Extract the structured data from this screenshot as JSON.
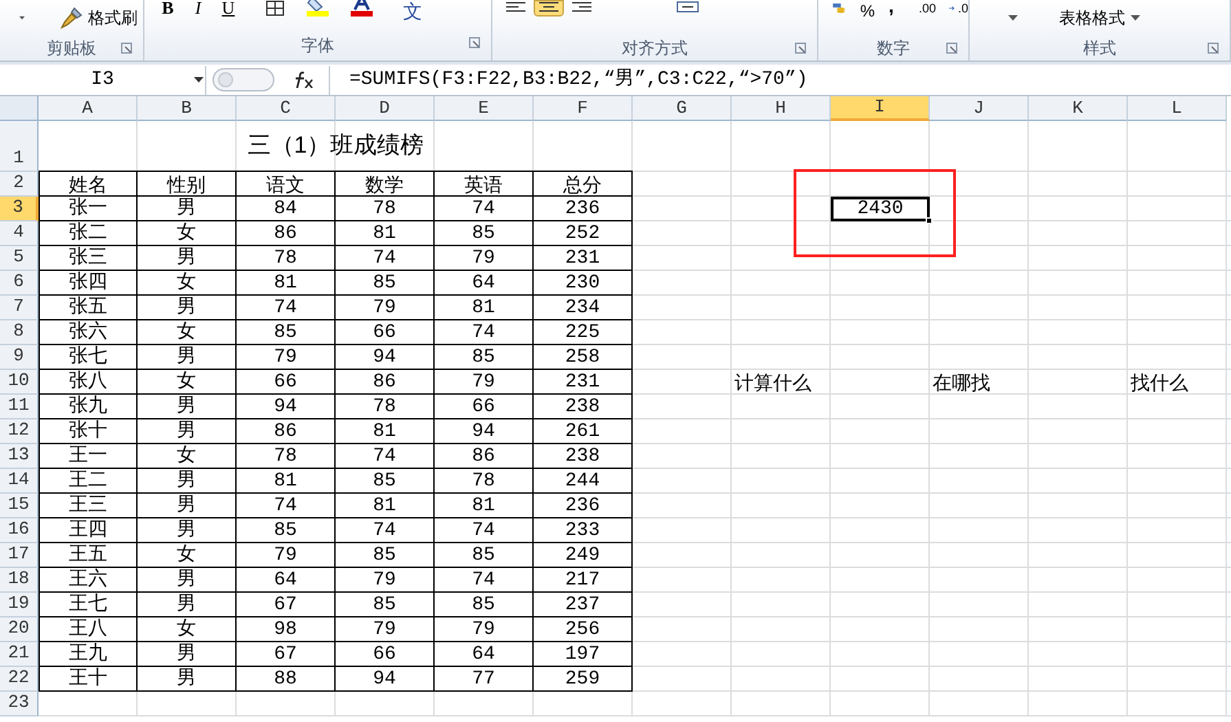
{
  "ribbon": {
    "groups": [
      {
        "label": "剪贴板"
      },
      {
        "label": "字体"
      },
      {
        "label": "对齐方式"
      },
      {
        "label": "数字"
      },
      {
        "label": "样式"
      }
    ],
    "format_painter": "格式刷",
    "bold": "B",
    "italic": "I",
    "underline": "U",
    "phonetic": "文",
    "percent": "%",
    "comma": ",",
    "decimal_buttons": [
      ".00",
      ".0"
    ],
    "table_format": "表格格式"
  },
  "formula_bar": {
    "name_box": "I3",
    "formula": "=SUMIFS(F3:F22,B3:B22,“男”,C3:C22,“>70”)"
  },
  "columns": [
    {
      "label": "A",
      "selected": false
    },
    {
      "label": "B",
      "selected": false
    },
    {
      "label": "C",
      "selected": false
    },
    {
      "label": "D",
      "selected": false
    },
    {
      "label": "E",
      "selected": false
    },
    {
      "label": "F",
      "selected": false
    },
    {
      "label": "G",
      "selected": false
    },
    {
      "label": "H",
      "selected": false
    },
    {
      "label": "I",
      "selected": true
    },
    {
      "label": "J",
      "selected": false
    },
    {
      "label": "K",
      "selected": false
    },
    {
      "label": "L",
      "selected": false
    }
  ],
  "rows": [
    {
      "label": "1",
      "selected": false
    },
    {
      "label": "2",
      "selected": false
    },
    {
      "label": "3",
      "selected": true
    },
    {
      "label": "4",
      "selected": false
    },
    {
      "label": "5",
      "selected": false
    },
    {
      "label": "6",
      "selected": false
    },
    {
      "label": "7",
      "selected": false
    },
    {
      "label": "8",
      "selected": false
    },
    {
      "label": "9",
      "selected": false
    },
    {
      "label": "10",
      "selected": false
    },
    {
      "label": "11",
      "selected": false
    },
    {
      "label": "12",
      "selected": false
    },
    {
      "label": "13",
      "selected": false
    },
    {
      "label": "14",
      "selected": false
    },
    {
      "label": "15",
      "selected": false
    },
    {
      "label": "16",
      "selected": false
    },
    {
      "label": "17",
      "selected": false
    },
    {
      "label": "18",
      "selected": false
    },
    {
      "label": "19",
      "selected": false
    },
    {
      "label": "20",
      "selected": false
    },
    {
      "label": "21",
      "selected": false
    },
    {
      "label": "22",
      "selected": false
    },
    {
      "label": "23",
      "selected": false
    }
  ],
  "table": {
    "title": "三（1）班成绩榜",
    "columns": [
      "姓名",
      "性别",
      "语文",
      "数学",
      "英语",
      "总分"
    ],
    "rows": [
      [
        "张一",
        "男",
        "84",
        "78",
        "74",
        "236"
      ],
      [
        "张二",
        "女",
        "86",
        "81",
        "85",
        "252"
      ],
      [
        "张三",
        "男",
        "78",
        "74",
        "79",
        "231"
      ],
      [
        "张四",
        "女",
        "81",
        "85",
        "64",
        "230"
      ],
      [
        "张五",
        "男",
        "74",
        "79",
        "81",
        "234"
      ],
      [
        "张六",
        "女",
        "85",
        "66",
        "74",
        "225"
      ],
      [
        "张七",
        "男",
        "79",
        "94",
        "85",
        "258"
      ],
      [
        "张八",
        "女",
        "66",
        "86",
        "79",
        "231"
      ],
      [
        "张九",
        "男",
        "94",
        "78",
        "66",
        "238"
      ],
      [
        "张十",
        "男",
        "86",
        "81",
        "94",
        "261"
      ],
      [
        "王一",
        "女",
        "78",
        "74",
        "86",
        "238"
      ],
      [
        "王二",
        "男",
        "81",
        "85",
        "78",
        "244"
      ],
      [
        "王三",
        "男",
        "74",
        "81",
        "81",
        "236"
      ],
      [
        "王四",
        "男",
        "85",
        "74",
        "74",
        "233"
      ],
      [
        "王五",
        "女",
        "79",
        "85",
        "85",
        "249"
      ],
      [
        "王六",
        "男",
        "64",
        "79",
        "74",
        "217"
      ],
      [
        "王七",
        "男",
        "67",
        "85",
        "85",
        "237"
      ],
      [
        "王八",
        "女",
        "98",
        "79",
        "79",
        "256"
      ],
      [
        "王九",
        "男",
        "67",
        "66",
        "64",
        "197"
      ],
      [
        "王十",
        "男",
        "88",
        "94",
        "77",
        "259"
      ]
    ]
  },
  "result_cell": {
    "value": "2430",
    "selected": true,
    "highlighted": true
  },
  "labels": [
    {
      "text": "计算什么"
    },
    {
      "text": "在哪找"
    },
    {
      "text": "找什么"
    }
  ]
}
